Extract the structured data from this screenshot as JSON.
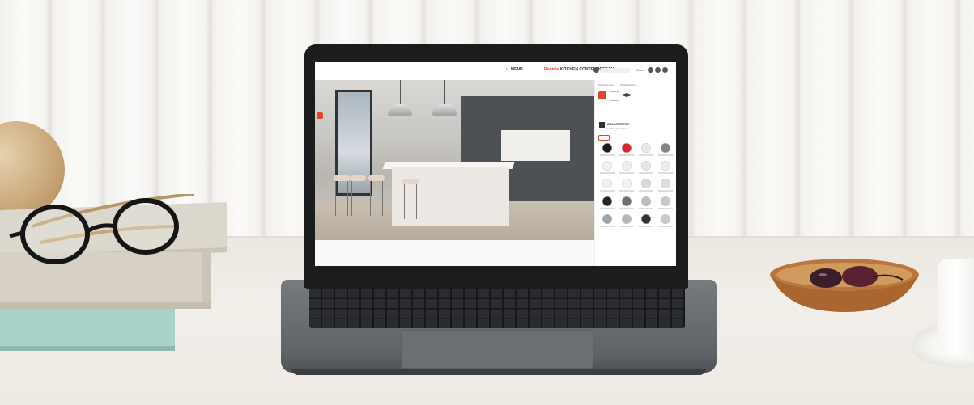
{
  "screen_ui": {
    "menu_label": "MENU",
    "brand_prefix": "Roomle",
    "brand_title": "KITCHEN CONTEMPORARY",
    "share_label": "Share",
    "panel": {
      "tabs": [
        "Selected color",
        "Finish options"
      ],
      "item_title": "COUNTERTOP",
      "item_sub": "Finish - Fossil gray"
    },
    "swatch_colors": [
      "#1c1c1c",
      "#d8262b",
      "#e7e7e4",
      "#7f8580",
      "#f1f1f1",
      "#ededeb",
      "#e5e5e2",
      "#ecebe8",
      "#f0f0ee",
      "#f2f2f0",
      "#d9dad8",
      "#dedfdd",
      "#222426",
      "#6c7072",
      "#b9bcbb",
      "#c7c9c6",
      "#9fa3a4",
      "#b5b8b9",
      "#2d3334",
      "#c5ccc5"
    ]
  },
  "colors": {
    "accent": "#e3452b",
    "laptop_bezel": "#1b1c1e",
    "laptop_body": "#6b6f74"
  }
}
